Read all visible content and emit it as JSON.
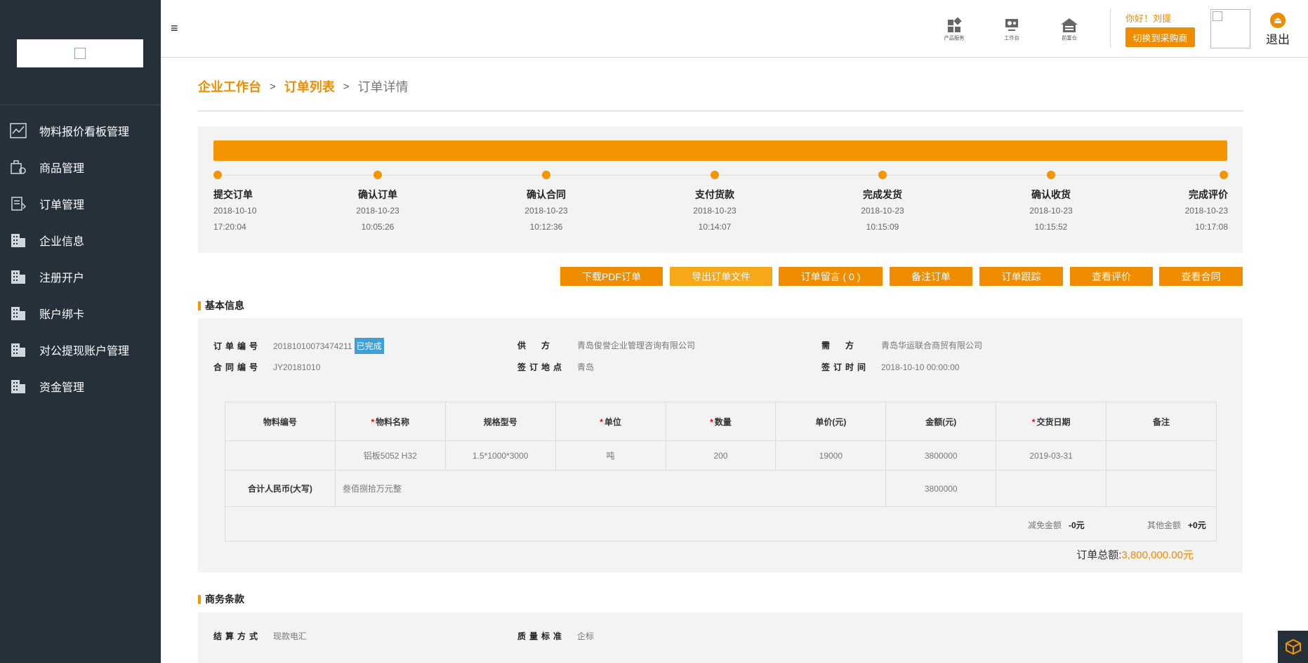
{
  "header": {
    "menu_toggle": "≡",
    "icons": [
      {
        "name": "product-service-icon",
        "label": "产品服务"
      },
      {
        "name": "workbench-icon",
        "label": "工作台"
      },
      {
        "name": "home-icon",
        "label": "前置仓"
      }
    ],
    "greeting": "你好！刘提",
    "switch_button": "切换到采购商",
    "logout": "退出",
    "accent": "#f08c00"
  },
  "sidebar": {
    "bg": "#25303a",
    "items": [
      {
        "label": "物料报价看板管理",
        "icon": "chart-icon"
      },
      {
        "label": "商品管理",
        "icon": "goods-icon"
      },
      {
        "label": "订单管理",
        "icon": "order-icon"
      },
      {
        "label": "企业信息",
        "icon": "building-icon"
      },
      {
        "label": "注册开户",
        "icon": "building-icon"
      },
      {
        "label": "账户绑卡",
        "icon": "building-icon"
      },
      {
        "label": "对公提现账户管理",
        "icon": "building-icon"
      },
      {
        "label": "资金管理",
        "icon": "building-icon"
      }
    ]
  },
  "breadcrumb": {
    "home": "企业工作台",
    "list": "订单列表",
    "current": "订单详情",
    "sep": ">"
  },
  "progress": {
    "percent": 100,
    "steps": [
      {
        "title": "提交订单",
        "date": "2018-10-10",
        "time": "17:20:04"
      },
      {
        "title": "确认订单",
        "date": "2018-10-23",
        "time": "10:05:26"
      },
      {
        "title": "确认合同",
        "date": "2018-10-23",
        "time": "10:12:36"
      },
      {
        "title": "支付货款",
        "date": "2018-10-23",
        "time": "10:14:07"
      },
      {
        "title": "完成发货",
        "date": "2018-10-23",
        "time": "10:15:09"
      },
      {
        "title": "确认收货",
        "date": "2018-10-23",
        "time": "10:15:52"
      },
      {
        "title": "完成评价",
        "date": "2018-10-23",
        "time": "10:17:08"
      }
    ]
  },
  "actions": [
    "下载PDF订单",
    "导出订单文件",
    "订单留言 ( 0 )",
    "备注订单",
    "订单跟踪",
    "查看评价",
    "查看合同"
  ],
  "basic_info": {
    "title": "基本信息",
    "order_no_label": "订单编号",
    "order_no": "20181010073474211",
    "status": "已完成",
    "supplier_label": "供方",
    "supplier": "青岛俊誉企业管理咨询有限公司",
    "buyer_label": "需方",
    "buyer": "青岛华运联合商贸有限公司",
    "contract_no_label": "合同编号",
    "contract_no": "JY20181010",
    "sign_place_label": "签订地点",
    "sign_place": "青岛",
    "sign_time_label": "签订时间",
    "sign_time": "2018-10-10 00:00:00"
  },
  "table": {
    "headers": [
      {
        "label": "物料编号",
        "required": false
      },
      {
        "label": "物料名称",
        "required": true
      },
      {
        "label": "规格型号",
        "required": false
      },
      {
        "label": "单位",
        "required": true
      },
      {
        "label": "数量",
        "required": true
      },
      {
        "label": "单价(元)",
        "required": false
      },
      {
        "label": "金额(元)",
        "required": false
      },
      {
        "label": "交货日期",
        "required": true
      },
      {
        "label": "备注",
        "required": false
      }
    ],
    "rows": [
      [
        "",
        "铝板5052 H32",
        "1.5*1000*3000",
        "吨",
        "200",
        "19000",
        "3800000",
        "2019-03-31",
        ""
      ]
    ],
    "sum_label": "合计人民币(大写)",
    "sum_text": "叁佰捌拾万元整",
    "sum_amount": "3800000",
    "discount_label": "减免金额",
    "discount_value": "-0元",
    "other_label": "其他金额",
    "other_value": "+0元",
    "total_label": "订单总额:",
    "total_value": "3,800,000.00元"
  },
  "terms": {
    "title": "商务条款",
    "settlement_label": "结算方式",
    "settlement": "现款电汇",
    "quality_label": "质量标准",
    "quality": "企标"
  }
}
